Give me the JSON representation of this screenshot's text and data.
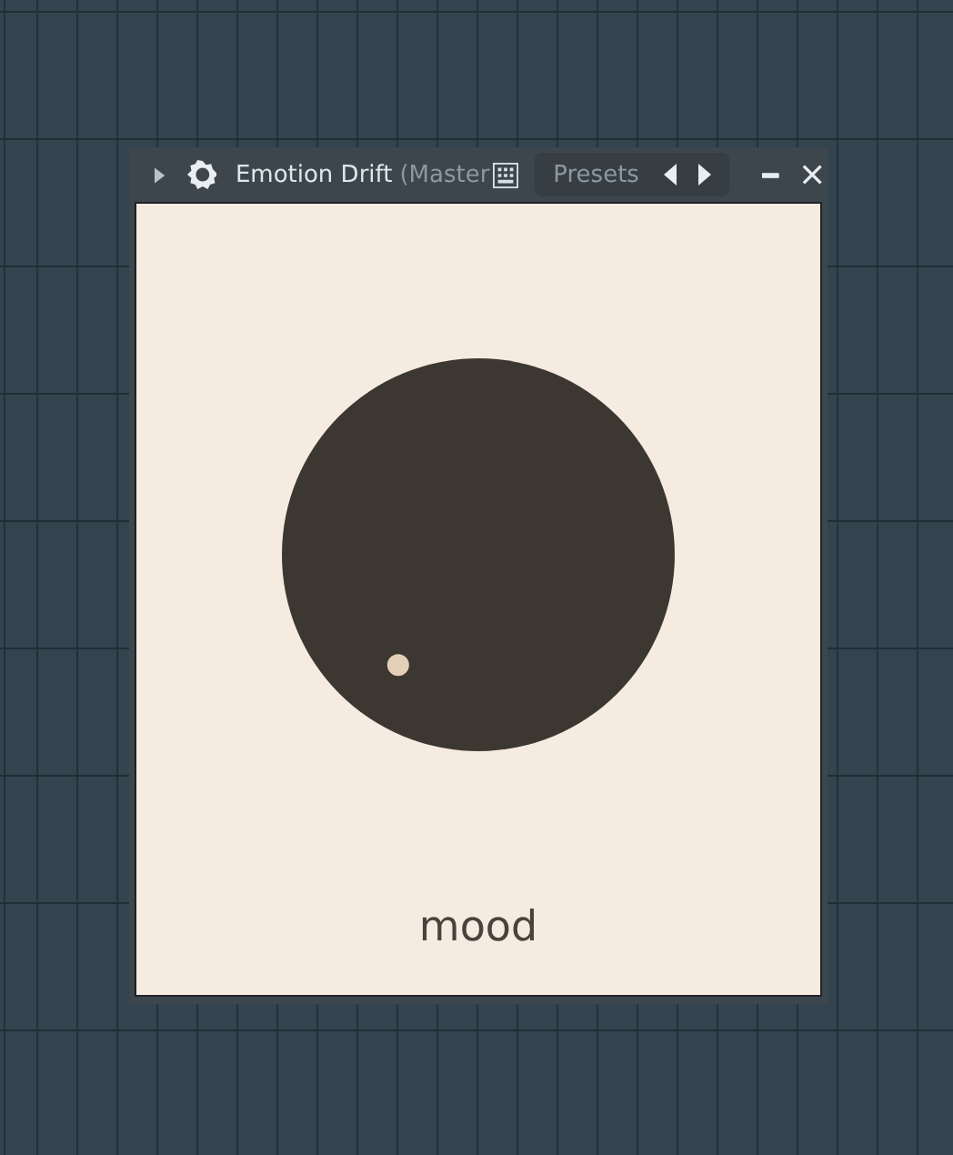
{
  "window": {
    "title": "Emotion Drift",
    "subtitle": "(Master",
    "presets_label": "Presets"
  },
  "knob": {
    "label": "mood"
  }
}
